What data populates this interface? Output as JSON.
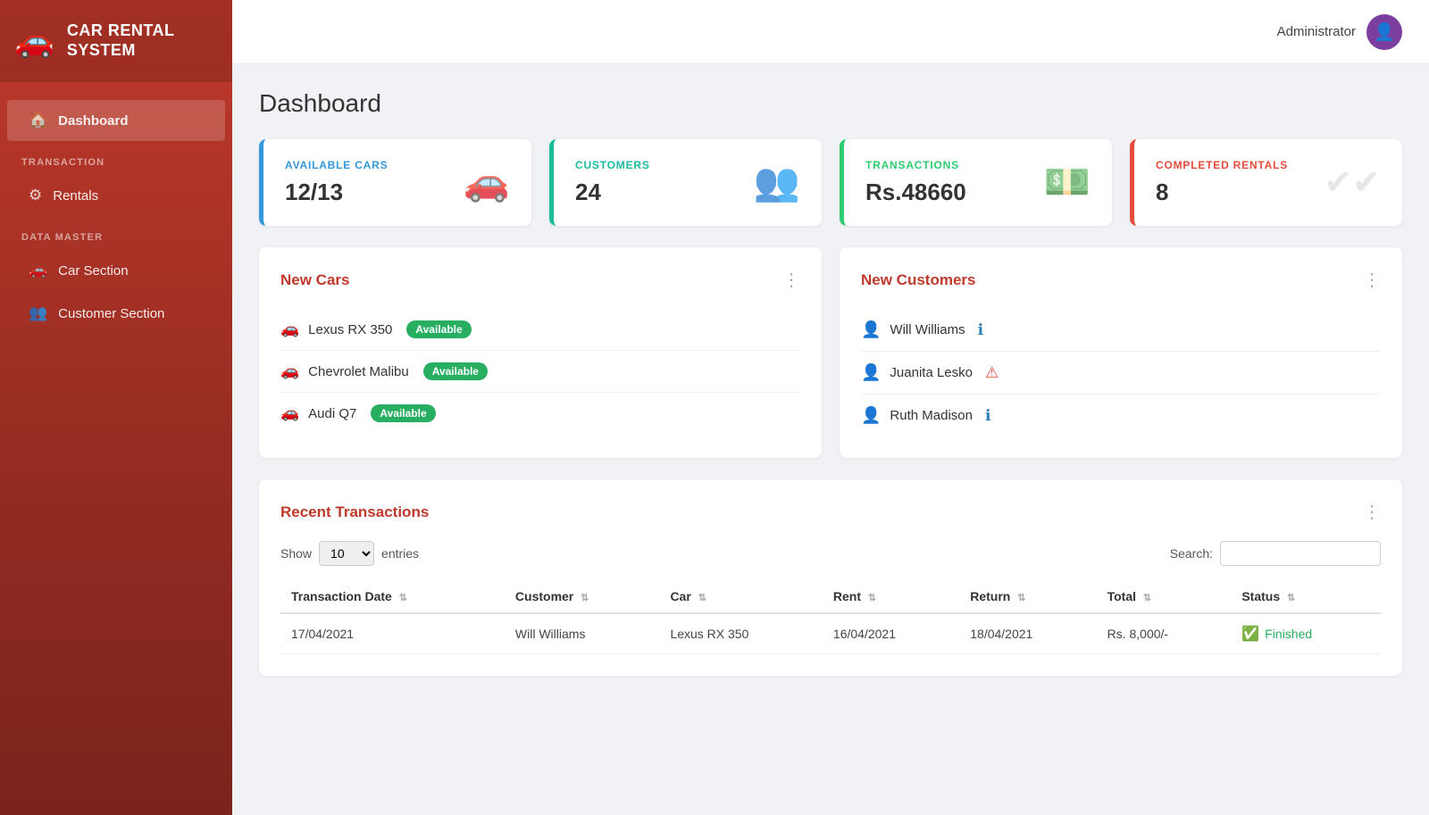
{
  "sidebar": {
    "title": "CAR RENTAL\nSYSTEM",
    "logo": "🚗",
    "nav": {
      "sections": [
        {
          "label": "",
          "items": [
            {
              "id": "dashboard",
              "label": "Dashboard",
              "icon": "🏠",
              "active": true
            }
          ]
        },
        {
          "label": "TRANSACTION",
          "items": [
            {
              "id": "rentals",
              "label": "Rentals",
              "icon": "⚙"
            }
          ]
        },
        {
          "label": "DATA MASTER",
          "items": [
            {
              "id": "car-section",
              "label": "Car Section",
              "icon": "🚗"
            },
            {
              "id": "customer-section",
              "label": "Customer Section",
              "icon": "👥"
            }
          ]
        }
      ]
    }
  },
  "topbar": {
    "user": "Administrator",
    "avatar_icon": "👤"
  },
  "page_title": "Dashboard",
  "stat_cards": [
    {
      "id": "available-cars",
      "label": "AVAILABLE CARS",
      "value": "12/13",
      "icon": "🚗",
      "color": "blue"
    },
    {
      "id": "customers",
      "label": "CUSTOMERS",
      "value": "24",
      "icon": "👥",
      "color": "teal"
    },
    {
      "id": "transactions",
      "label": "TRANSACTIONS",
      "value": "Rs.48660",
      "icon": "💵",
      "color": "green"
    },
    {
      "id": "completed-rentals",
      "label": "COMPLETED RENTALS",
      "value": "8",
      "icon": "✔",
      "color": "red"
    }
  ],
  "new_cars_panel": {
    "title": "New Cars",
    "menu_icon": "⋮",
    "cars": [
      {
        "name": "Lexus RX 350",
        "status": "Available"
      },
      {
        "name": "Chevrolet Malibu",
        "status": "Available"
      },
      {
        "name": "Audi Q7",
        "status": "Available"
      }
    ]
  },
  "new_customers_panel": {
    "title": "New Customers",
    "menu_icon": "⋮",
    "customers": [
      {
        "name": "Will Williams",
        "status_color": "blue"
      },
      {
        "name": "Juanita Lesko",
        "status_color": "red"
      },
      {
        "name": "Ruth Madison",
        "status_color": "blue"
      }
    ]
  },
  "transactions_panel": {
    "title": "Recent Transactions",
    "menu_icon": "⋮",
    "show_label": "Show",
    "show_value": "10",
    "entries_label": "entries",
    "search_label": "Search:",
    "search_placeholder": "",
    "columns": [
      "Transaction Date",
      "Customer",
      "Car",
      "Rent",
      "Return",
      "Total",
      "Status"
    ],
    "rows": [
      {
        "transaction_date": "17/04/2021",
        "customer": "Will Williams",
        "car": "Lexus RX 350",
        "rent": "16/04/2021",
        "return": "18/04/2021",
        "total": "Rs. 8,000/-",
        "status": "Finished"
      }
    ]
  }
}
